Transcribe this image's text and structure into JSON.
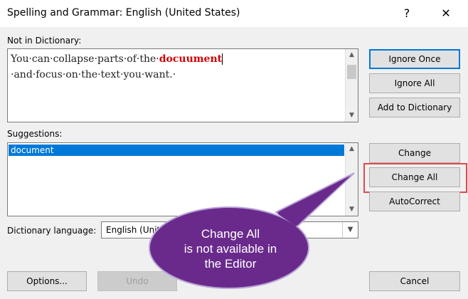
{
  "window": {
    "title": "Spelling and Grammar: English (United States)",
    "help_symbol": "?",
    "close_symbol": "✕"
  },
  "not_in_dictionary": {
    "label": "Not in Dictionary:",
    "text_before": "You·can·collapse·parts·of·the·",
    "misspelled": "docuument",
    "text_after": "·and·focus·on·the·text·you·want.·"
  },
  "suggestions": {
    "label": "Suggestions:",
    "items": [
      "document"
    ]
  },
  "dictionary_language": {
    "label": "Dictionary language:",
    "value": "English (Unit"
  },
  "buttons": {
    "ignore_once": "Ignore Once",
    "ignore_all": "Ignore All",
    "add_to_dictionary": "Add to Dictionary",
    "change": "Change",
    "change_all": "Change All",
    "autocorrect": "AutoCorrect",
    "options": "Options...",
    "undo": "Undo",
    "cancel": "Cancel"
  },
  "callout": {
    "line1": "Change All",
    "line2": "is not available in",
    "line3": "the Editor",
    "color": "#6a2a8c"
  }
}
